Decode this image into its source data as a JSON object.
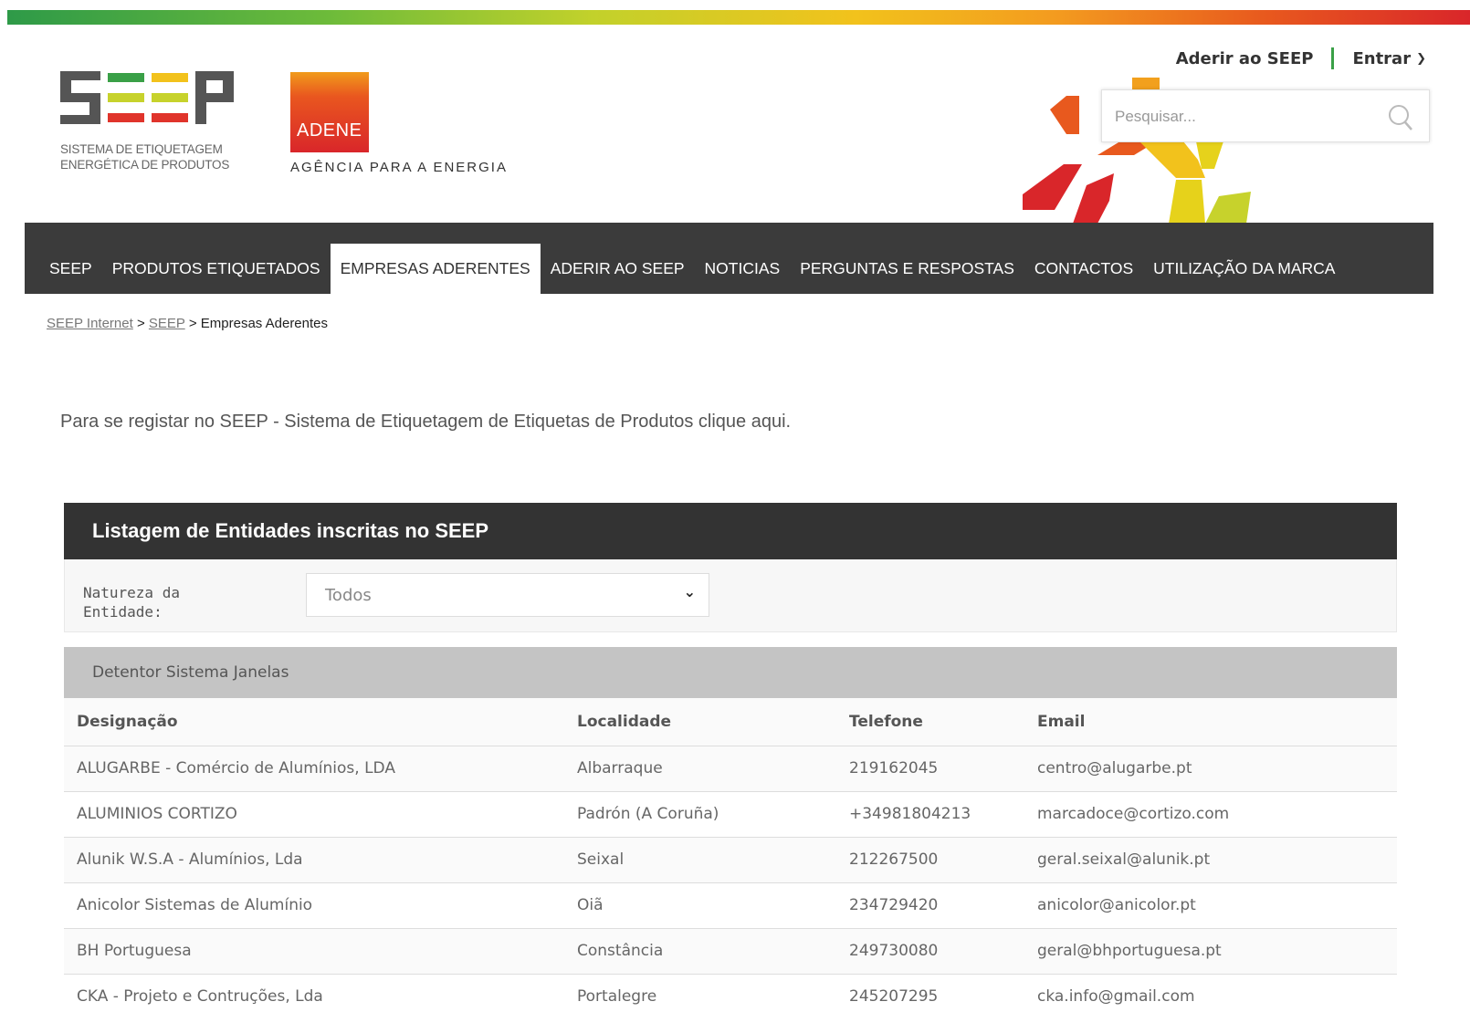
{
  "brand": {
    "seep_sub_line1": "SISTEMA DE ETIQUETAGEM",
    "seep_sub_line2": "ENERGÉTICA DE PRODUTOS",
    "adene_name": "ADENE",
    "adene_tagline": "AGÊNCIA PARA A ENERGIA"
  },
  "header": {
    "join_link": "Aderir ao SEEP",
    "login_link": "Entrar",
    "search_placeholder": "Pesquisar..."
  },
  "nav": {
    "items": [
      {
        "label": "SEEP"
      },
      {
        "label": "PRODUTOS ETIQUETADOS"
      },
      {
        "label": "EMPRESAS ADERENTES",
        "active": true
      },
      {
        "label": "ADERIR AO SEEP"
      },
      {
        "label": "NOTICIAS"
      },
      {
        "label": "PERGUNTAS E RESPOSTAS"
      },
      {
        "label": "CONTACTOS"
      },
      {
        "label": "UTILIZAÇÃO DA MARCA"
      }
    ]
  },
  "breadcrumb": {
    "items": [
      "SEEP Internet",
      "SEEP"
    ],
    "separator": ">",
    "current": "Empresas Aderentes"
  },
  "intro_text": "Para se registar no SEEP - Sistema de Etiquetagem de Etiquetas de Produtos clique aqui.",
  "panel": {
    "title": "Listagem de Entidades inscritas no SEEP",
    "filter_label": "Natureza da Entidade:",
    "filter_value": "Todos",
    "group_title": "Detentor Sistema Janelas",
    "columns": [
      "Designação",
      "Localidade",
      "Telefone",
      "Email"
    ],
    "rows": [
      [
        "ALUGARBE - Comércio de Alumínios, LDA",
        "Albarraque",
        "219162045",
        "centro@alugarbe.pt"
      ],
      [
        "ALUMINIOS CORTIZO",
        "Padrón (A Coruña)",
        "+34981804213",
        "marcadoce@cortizo.com"
      ],
      [
        "Alunik W.S.A - Alumínios, Lda",
        "Seixal",
        "212267500",
        "geral.seixal@alunik.pt"
      ],
      [
        "Anicolor Sistemas de Alumínio",
        "Oiã",
        "234729420",
        "anicolor@anicolor.pt"
      ],
      [
        "BH Portuguesa",
        "Constância",
        "249730080",
        "geral@bhportuguesa.pt"
      ],
      [
        "CKA - Projeto e Contruções, Lda",
        "Portalegre",
        "245207295",
        "cka.info@gmail.com"
      ]
    ]
  },
  "colors": {
    "nav_bg": "#3b3b3b",
    "panel_header_bg": "#333333",
    "group_bar_bg": "#c4c4c4",
    "accent_green": "#3aa047"
  }
}
